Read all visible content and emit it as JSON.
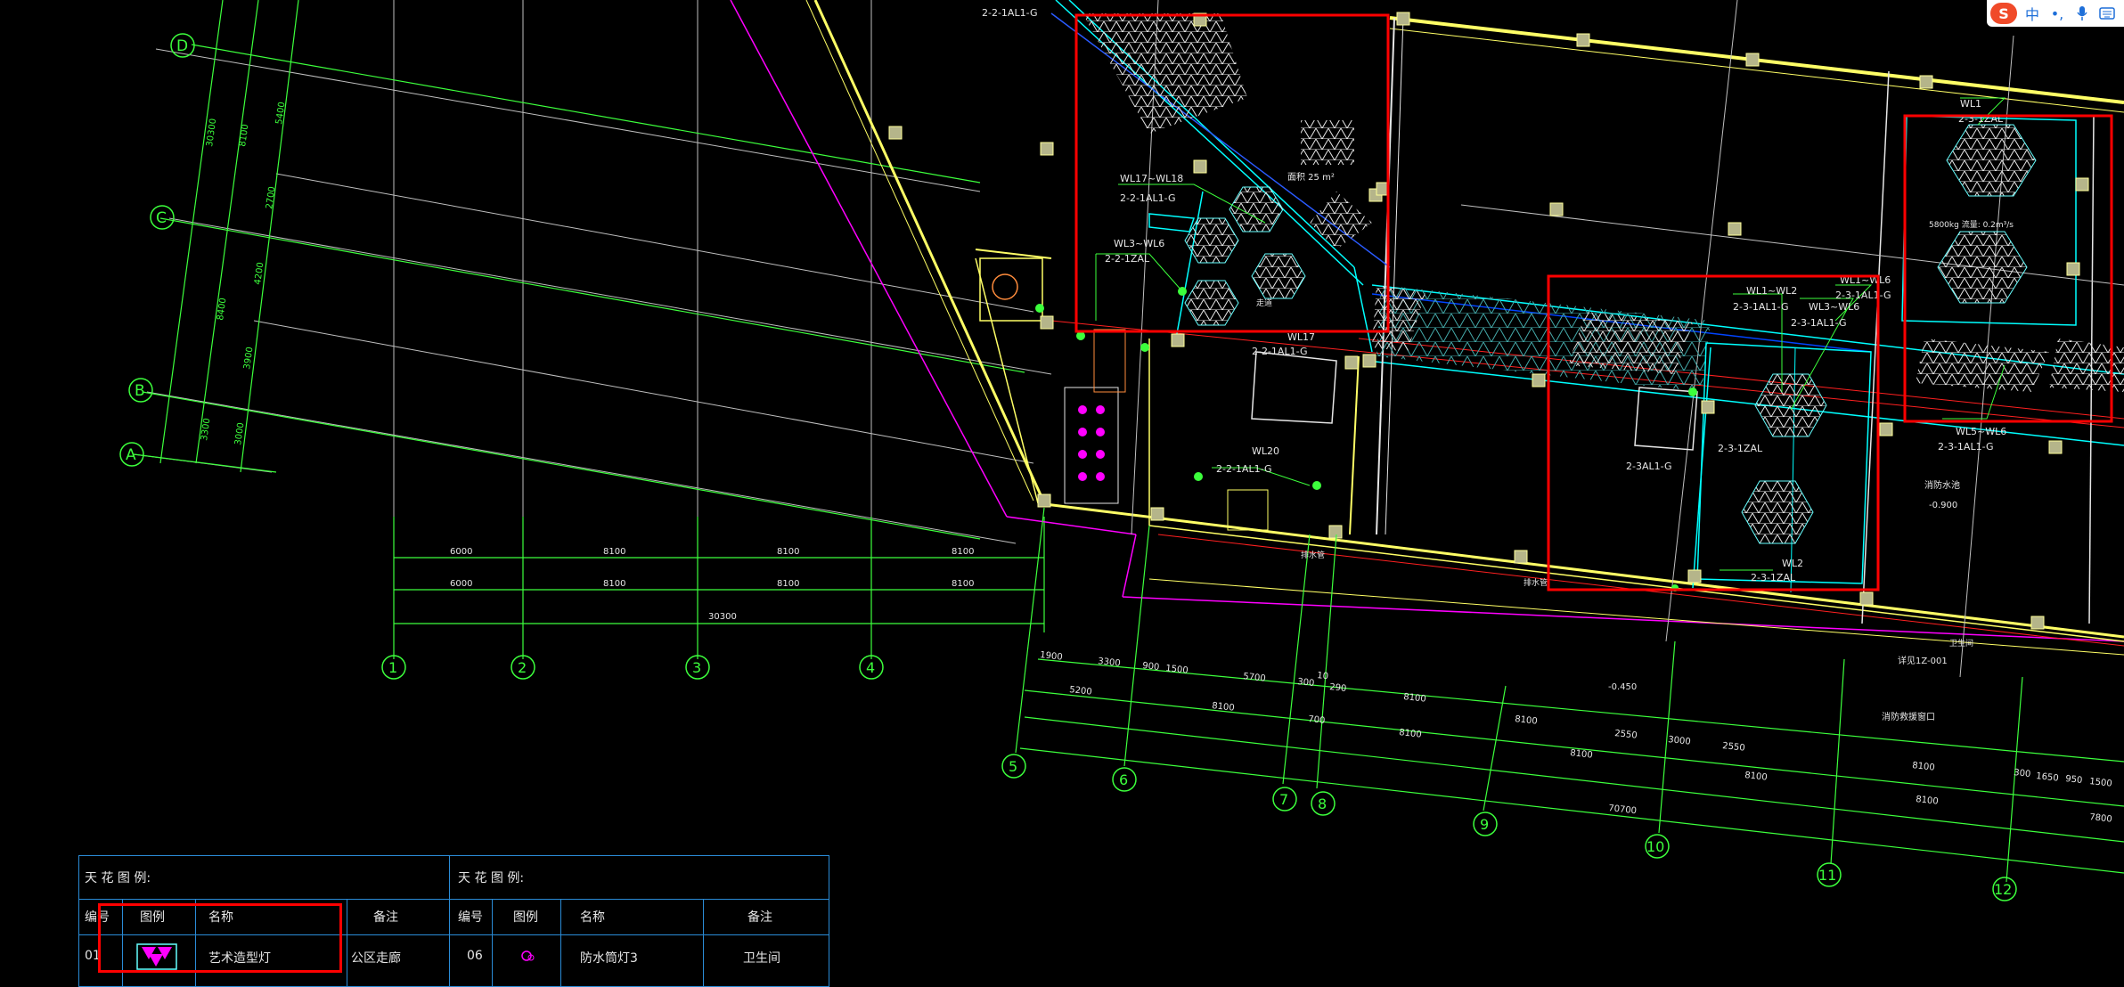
{
  "toolbar": {
    "logo": "S",
    "lang": "中",
    "punct": "•,",
    "voice_icon": "microphone-icon",
    "grid_icon": "keyboard-icon"
  },
  "axes": {
    "rows": [
      "D",
      "C",
      "B",
      "A"
    ],
    "cols_left": [
      "1",
      "2",
      "3",
      "4"
    ],
    "cols_right": [
      "5",
      "6",
      "7",
      "8",
      "9",
      "10",
      "11",
      "12"
    ]
  },
  "dims_left": {
    "row1": [
      "6000",
      "8100",
      "8100",
      "8100"
    ],
    "row2": [
      "6000",
      "8100",
      "8100",
      "8100"
    ],
    "total": "30300",
    "vertical": [
      "30300",
      "8100",
      "5400",
      "2700",
      "4200",
      "8400",
      "3900",
      "3300",
      "3000"
    ]
  },
  "dims_right": {
    "row1": [
      "1900",
      "3300",
      "900",
      "1500",
      "5700",
      "300",
      "10",
      "290",
      "8100",
      "2550",
      "3000",
      "2550",
      "8100",
      "300",
      "1650",
      "950",
      "1500"
    ],
    "row2": [
      "5200",
      "8100",
      "700",
      "8100",
      "8100"
    ],
    "row3": [
      "8100",
      "8100",
      "8100",
      "7800"
    ],
    "total": "70700"
  },
  "labels": {
    "wl_a": "2-2-1AL1-G",
    "wl_b": "WL17~WL18",
    "wl_b2": "2-2-1AL1-G",
    "wl_c": "WL3~WL6",
    "wl_c2": "2-2-1ZAL",
    "wl_d": "WL17",
    "wl_d2": "2-2-1AL1-G",
    "wl_e": "WL20",
    "wl_e2": "2-2-1AL1-G",
    "wl_f": "WL1~WL2",
    "wl_f2": "2-3-1AL1-G",
    "wl_g": "WL3~WL6",
    "wl_g2": "2-3-1AL1-G",
    "wl_h": "WL1~WL6",
    "wl_h2": "2-3-1AL1-G",
    "wl_i": "2-3AL1-G",
    "wl_j": "2-3-1ZAL",
    "wl_k": "WL2",
    "wl_k2": "2-3-1ZAL",
    "wl_l": "WL1",
    "wl_l2": "2-3-1ZAL",
    "wl_m": "WL5~WL6",
    "wl_m2": "2-3-1AL1-G",
    "area": "面积 25 m²",
    "area2": "5800kg  流量: 0.2m³/s",
    "hydrant": "消防水池",
    "elev1": "-0.900",
    "elev2": "-0.450",
    "room1": "排水管",
    "room2": "排水管",
    "room3": "卫生间",
    "note1": "详见1Z-001",
    "note2": "消防救援窗口",
    "stair": "走道"
  },
  "legend": {
    "left_title": "天 花 图 例:",
    "right_title": "天 花 图 例:",
    "headers_left": [
      "编号",
      "图例",
      "名称",
      "备注"
    ],
    "headers_right": [
      "编号",
      "图例",
      "名称",
      "备注"
    ],
    "row_left": {
      "no": "01",
      "name": "艺术造型灯",
      "remark": "公区走廊"
    },
    "row_right": {
      "no": "06",
      "name": "防水筒灯3",
      "remark": "卫生间"
    }
  },
  "colors": {
    "grid": "#3cff3c",
    "wall": "#ffff66",
    "highlight": "#ff0000",
    "cyan": "#00ffff",
    "magenta": "#ff00ff"
  }
}
